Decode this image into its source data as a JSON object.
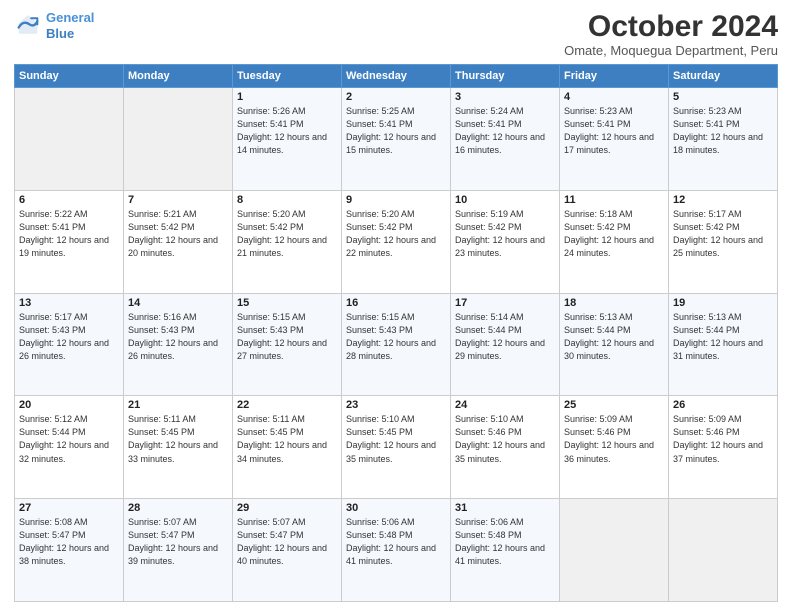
{
  "logo": {
    "line1": "General",
    "line2": "Blue"
  },
  "title": "October 2024",
  "subtitle": "Omate, Moquegua Department, Peru",
  "days_header": [
    "Sunday",
    "Monday",
    "Tuesday",
    "Wednesday",
    "Thursday",
    "Friday",
    "Saturday"
  ],
  "weeks": [
    [
      {
        "day": "",
        "sunrise": "",
        "sunset": "",
        "daylight": ""
      },
      {
        "day": "",
        "sunrise": "",
        "sunset": "",
        "daylight": ""
      },
      {
        "day": "1",
        "sunrise": "Sunrise: 5:26 AM",
        "sunset": "Sunset: 5:41 PM",
        "daylight": "Daylight: 12 hours and 14 minutes."
      },
      {
        "day": "2",
        "sunrise": "Sunrise: 5:25 AM",
        "sunset": "Sunset: 5:41 PM",
        "daylight": "Daylight: 12 hours and 15 minutes."
      },
      {
        "day": "3",
        "sunrise": "Sunrise: 5:24 AM",
        "sunset": "Sunset: 5:41 PM",
        "daylight": "Daylight: 12 hours and 16 minutes."
      },
      {
        "day": "4",
        "sunrise": "Sunrise: 5:23 AM",
        "sunset": "Sunset: 5:41 PM",
        "daylight": "Daylight: 12 hours and 17 minutes."
      },
      {
        "day": "5",
        "sunrise": "Sunrise: 5:23 AM",
        "sunset": "Sunset: 5:41 PM",
        "daylight": "Daylight: 12 hours and 18 minutes."
      }
    ],
    [
      {
        "day": "6",
        "sunrise": "Sunrise: 5:22 AM",
        "sunset": "Sunset: 5:41 PM",
        "daylight": "Daylight: 12 hours and 19 minutes."
      },
      {
        "day": "7",
        "sunrise": "Sunrise: 5:21 AM",
        "sunset": "Sunset: 5:42 PM",
        "daylight": "Daylight: 12 hours and 20 minutes."
      },
      {
        "day": "8",
        "sunrise": "Sunrise: 5:20 AM",
        "sunset": "Sunset: 5:42 PM",
        "daylight": "Daylight: 12 hours and 21 minutes."
      },
      {
        "day": "9",
        "sunrise": "Sunrise: 5:20 AM",
        "sunset": "Sunset: 5:42 PM",
        "daylight": "Daylight: 12 hours and 22 minutes."
      },
      {
        "day": "10",
        "sunrise": "Sunrise: 5:19 AM",
        "sunset": "Sunset: 5:42 PM",
        "daylight": "Daylight: 12 hours and 23 minutes."
      },
      {
        "day": "11",
        "sunrise": "Sunrise: 5:18 AM",
        "sunset": "Sunset: 5:42 PM",
        "daylight": "Daylight: 12 hours and 24 minutes."
      },
      {
        "day": "12",
        "sunrise": "Sunrise: 5:17 AM",
        "sunset": "Sunset: 5:42 PM",
        "daylight": "Daylight: 12 hours and 25 minutes."
      }
    ],
    [
      {
        "day": "13",
        "sunrise": "Sunrise: 5:17 AM",
        "sunset": "Sunset: 5:43 PM",
        "daylight": "Daylight: 12 hours and 26 minutes."
      },
      {
        "day": "14",
        "sunrise": "Sunrise: 5:16 AM",
        "sunset": "Sunset: 5:43 PM",
        "daylight": "Daylight: 12 hours and 26 minutes."
      },
      {
        "day": "15",
        "sunrise": "Sunrise: 5:15 AM",
        "sunset": "Sunset: 5:43 PM",
        "daylight": "Daylight: 12 hours and 27 minutes."
      },
      {
        "day": "16",
        "sunrise": "Sunrise: 5:15 AM",
        "sunset": "Sunset: 5:43 PM",
        "daylight": "Daylight: 12 hours and 28 minutes."
      },
      {
        "day": "17",
        "sunrise": "Sunrise: 5:14 AM",
        "sunset": "Sunset: 5:44 PM",
        "daylight": "Daylight: 12 hours and 29 minutes."
      },
      {
        "day": "18",
        "sunrise": "Sunrise: 5:13 AM",
        "sunset": "Sunset: 5:44 PM",
        "daylight": "Daylight: 12 hours and 30 minutes."
      },
      {
        "day": "19",
        "sunrise": "Sunrise: 5:13 AM",
        "sunset": "Sunset: 5:44 PM",
        "daylight": "Daylight: 12 hours and 31 minutes."
      }
    ],
    [
      {
        "day": "20",
        "sunrise": "Sunrise: 5:12 AM",
        "sunset": "Sunset: 5:44 PM",
        "daylight": "Daylight: 12 hours and 32 minutes."
      },
      {
        "day": "21",
        "sunrise": "Sunrise: 5:11 AM",
        "sunset": "Sunset: 5:45 PM",
        "daylight": "Daylight: 12 hours and 33 minutes."
      },
      {
        "day": "22",
        "sunrise": "Sunrise: 5:11 AM",
        "sunset": "Sunset: 5:45 PM",
        "daylight": "Daylight: 12 hours and 34 minutes."
      },
      {
        "day": "23",
        "sunrise": "Sunrise: 5:10 AM",
        "sunset": "Sunset: 5:45 PM",
        "daylight": "Daylight: 12 hours and 35 minutes."
      },
      {
        "day": "24",
        "sunrise": "Sunrise: 5:10 AM",
        "sunset": "Sunset: 5:46 PM",
        "daylight": "Daylight: 12 hours and 35 minutes."
      },
      {
        "day": "25",
        "sunrise": "Sunrise: 5:09 AM",
        "sunset": "Sunset: 5:46 PM",
        "daylight": "Daylight: 12 hours and 36 minutes."
      },
      {
        "day": "26",
        "sunrise": "Sunrise: 5:09 AM",
        "sunset": "Sunset: 5:46 PM",
        "daylight": "Daylight: 12 hours and 37 minutes."
      }
    ],
    [
      {
        "day": "27",
        "sunrise": "Sunrise: 5:08 AM",
        "sunset": "Sunset: 5:47 PM",
        "daylight": "Daylight: 12 hours and 38 minutes."
      },
      {
        "day": "28",
        "sunrise": "Sunrise: 5:07 AM",
        "sunset": "Sunset: 5:47 PM",
        "daylight": "Daylight: 12 hours and 39 minutes."
      },
      {
        "day": "29",
        "sunrise": "Sunrise: 5:07 AM",
        "sunset": "Sunset: 5:47 PM",
        "daylight": "Daylight: 12 hours and 40 minutes."
      },
      {
        "day": "30",
        "sunrise": "Sunrise: 5:06 AM",
        "sunset": "Sunset: 5:48 PM",
        "daylight": "Daylight: 12 hours and 41 minutes."
      },
      {
        "day": "31",
        "sunrise": "Sunrise: 5:06 AM",
        "sunset": "Sunset: 5:48 PM",
        "daylight": "Daylight: 12 hours and 41 minutes."
      },
      {
        "day": "",
        "sunrise": "",
        "sunset": "",
        "daylight": ""
      },
      {
        "day": "",
        "sunrise": "",
        "sunset": "",
        "daylight": ""
      }
    ]
  ]
}
